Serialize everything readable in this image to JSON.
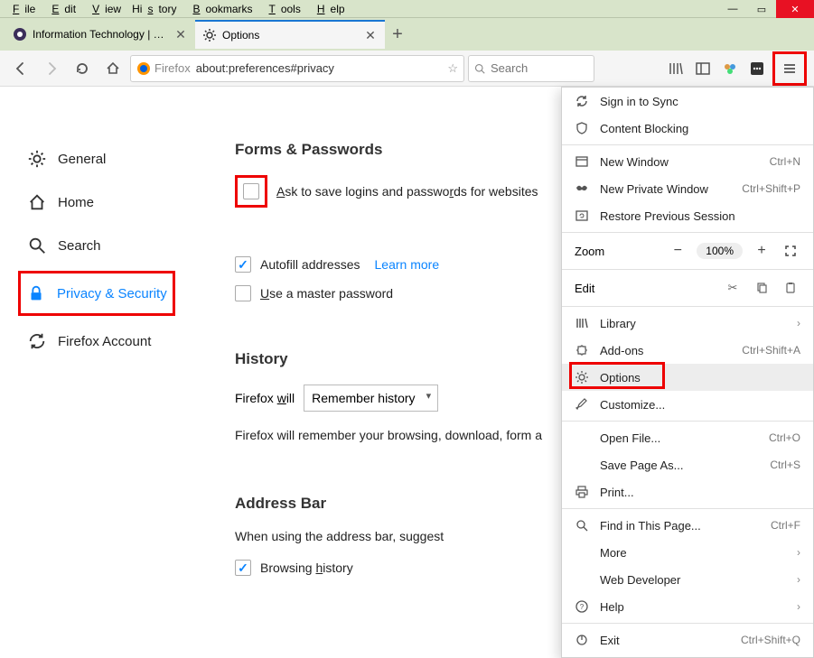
{
  "menubar": [
    "File",
    "Edit",
    "View",
    "History",
    "Bookmarks",
    "Tools",
    "Help"
  ],
  "tabs": [
    {
      "title": "Information Technology | Univ",
      "active": false
    },
    {
      "title": "Options",
      "active": true
    }
  ],
  "url": "about:preferences#privacy",
  "url_identity": "Firefox",
  "search_placeholder": "Search",
  "sidebar": {
    "items": [
      {
        "label": "General"
      },
      {
        "label": "Home"
      },
      {
        "label": "Search"
      },
      {
        "label": "Privacy & Security"
      },
      {
        "label": "Firefox Account"
      }
    ]
  },
  "forms": {
    "title": "Forms & Passwords",
    "ask_save": "Ask to save logins and passwords for websites",
    "autofill": "Autofill addresses",
    "learn_more": "Learn more",
    "master": "Use a master password"
  },
  "history": {
    "title": "History",
    "label": "Firefox will",
    "select": "Remember history",
    "desc": "Firefox will remember your browsing, download, form a"
  },
  "addressbar": {
    "title": "Address Bar",
    "desc": "When using the address bar, suggest",
    "browsing": "Browsing history"
  },
  "menu": {
    "signin": "Sign in to Sync",
    "contentblocking": "Content Blocking",
    "newwindow": {
      "label": "New Window",
      "shortcut": "Ctrl+N"
    },
    "newprivate": {
      "label": "New Private Window",
      "shortcut": "Ctrl+Shift+P"
    },
    "restore": "Restore Previous Session",
    "zoom": {
      "label": "Zoom",
      "value": "100%"
    },
    "edit": "Edit",
    "library": "Library",
    "addons": {
      "label": "Add-ons",
      "shortcut": "Ctrl+Shift+A"
    },
    "options": "Options",
    "customize": "Customize...",
    "openfile": {
      "label": "Open File...",
      "shortcut": "Ctrl+O"
    },
    "savepage": {
      "label": "Save Page As...",
      "shortcut": "Ctrl+S"
    },
    "print": "Print...",
    "find": {
      "label": "Find in This Page...",
      "shortcut": "Ctrl+F"
    },
    "more": "More",
    "webdev": "Web Developer",
    "help": "Help",
    "exit": {
      "label": "Exit",
      "shortcut": "Ctrl+Shift+Q"
    }
  }
}
